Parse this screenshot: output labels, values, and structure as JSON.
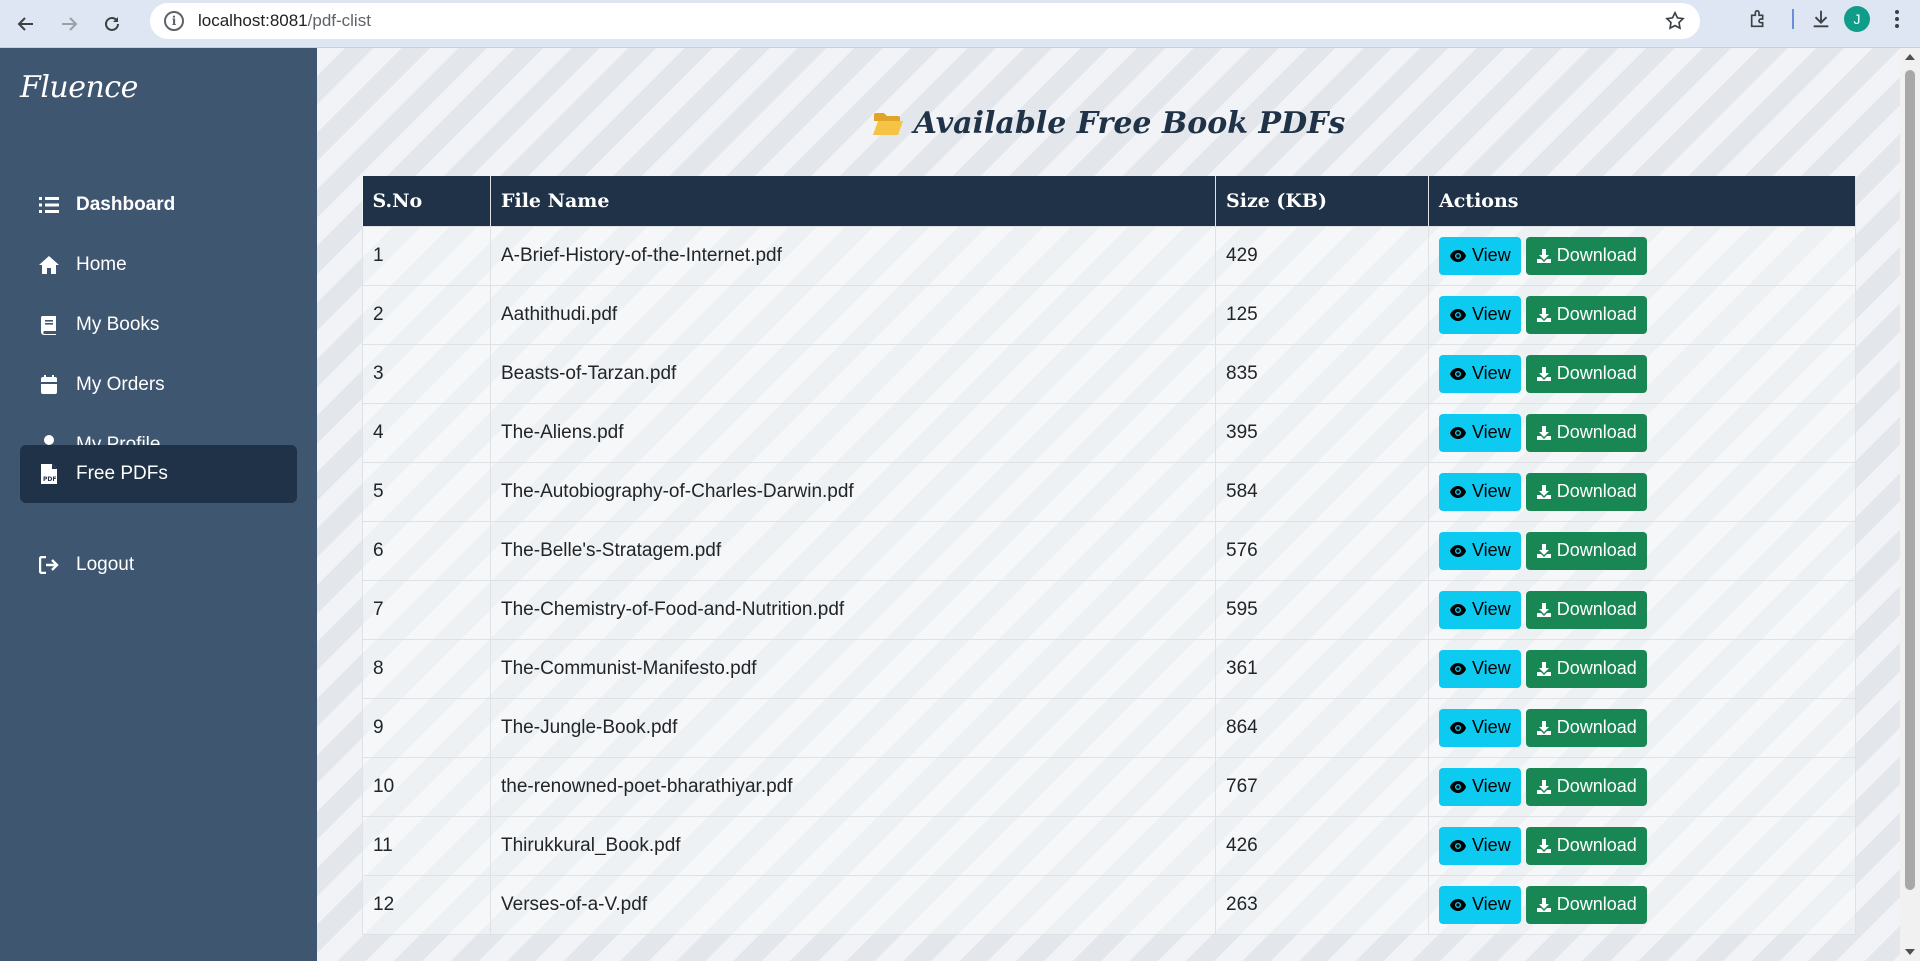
{
  "browser": {
    "url_host": "localhost:8081",
    "url_path": "/pdf-clist",
    "avatar_letter": "J"
  },
  "sidebar": {
    "brand": "Fluence",
    "items": [
      {
        "label": "Dashboard",
        "icon": "list-icon"
      },
      {
        "label": "Home",
        "icon": "home-icon"
      },
      {
        "label": "My Books",
        "icon": "book-icon"
      },
      {
        "label": "My Orders",
        "icon": "calendar-icon"
      },
      {
        "label": "My Profile",
        "icon": "user-icon"
      },
      {
        "label": "Free PDFs",
        "icon": "pdf-file-icon",
        "active": true
      },
      {
        "label": "Logout",
        "icon": "logout-icon"
      }
    ]
  },
  "main": {
    "title": "Available Free Book PDFs",
    "columns": [
      "S.No",
      "File Name",
      "Size (KB)",
      "Actions"
    ],
    "view_label": "View",
    "download_label": "Download",
    "rows": [
      {
        "sno": "1",
        "name": "A-Brief-History-of-the-Internet.pdf",
        "size": "429"
      },
      {
        "sno": "2",
        "name": "Aathithudi.pdf",
        "size": "125"
      },
      {
        "sno": "3",
        "name": "Beasts-of-Tarzan.pdf",
        "size": "835"
      },
      {
        "sno": "4",
        "name": "The-Aliens.pdf",
        "size": "395"
      },
      {
        "sno": "5",
        "name": "The-Autobiography-of-Charles-Darwin.pdf",
        "size": "584"
      },
      {
        "sno": "6",
        "name": "The-Belle's-Stratagem.pdf",
        "size": "576"
      },
      {
        "sno": "7",
        "name": "The-Chemistry-of-Food-and-Nutrition.pdf",
        "size": "595"
      },
      {
        "sno": "8",
        "name": "The-Communist-Manifesto.pdf",
        "size": "361"
      },
      {
        "sno": "9",
        "name": "The-Jungle-Book.pdf",
        "size": "864"
      },
      {
        "sno": "10",
        "name": "the-renowned-poet-bharathiyar.pdf",
        "size": "767"
      },
      {
        "sno": "11",
        "name": "Thirukkural_Book.pdf",
        "size": "426"
      },
      {
        "sno": "12",
        "name": "Verses-of-a-V.pdf",
        "size": "263"
      }
    ]
  },
  "colors": {
    "sidebar_bg": "#3f5670",
    "active_bg": "#1f3247",
    "header_bg": "#1f3247",
    "view_btn": "#0dcaf0",
    "download_btn": "#198754"
  }
}
